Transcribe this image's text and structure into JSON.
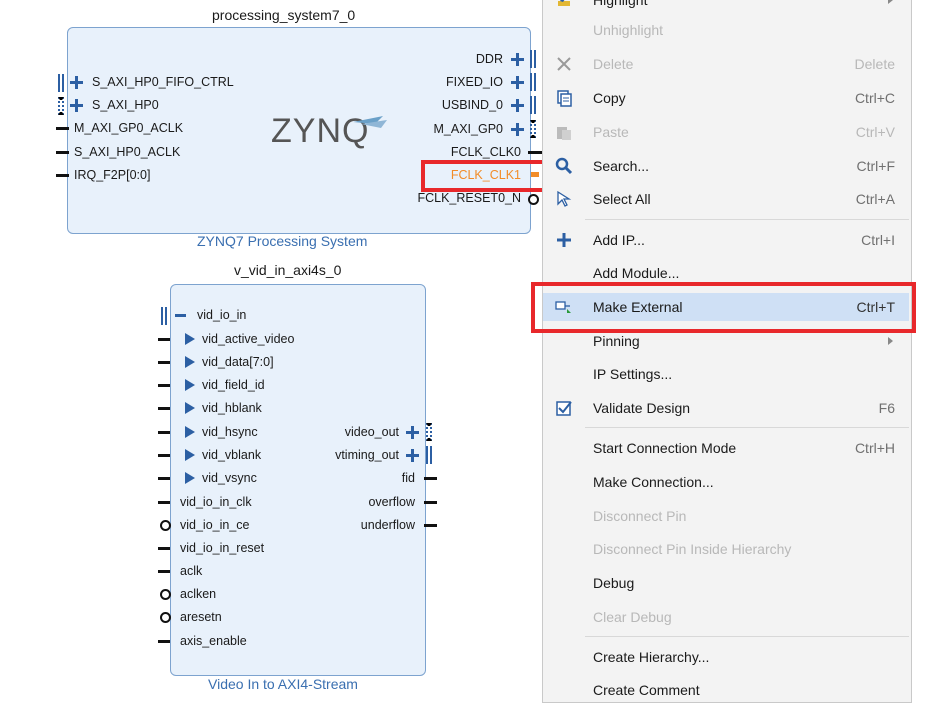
{
  "ps": {
    "title": "processing_system7_0",
    "subtitle": "ZYNQ7 Processing System",
    "logo": "ZYNQ",
    "left_pins": [
      "S_AXI_HP0_FIFO_CTRL",
      "S_AXI_HP0",
      "M_AXI_GP0_ACLK",
      "S_AXI_HP0_ACLK",
      "IRQ_F2P[0:0]"
    ],
    "right_pins": [
      "DDR",
      "FIXED_IO",
      "USBIND_0",
      "M_AXI_GP0",
      "FCLK_CLK0",
      "FCLK_CLK1",
      "FCLK_RESET0_N"
    ],
    "selected_pin": "FCLK_CLK1"
  },
  "vid": {
    "title": "v_vid_in_axi4s_0",
    "subtitle": "Video In to AXI4-Stream",
    "left_pins": [
      "vid_io_in",
      "vid_active_video",
      "vid_data[7:0]",
      "vid_field_id",
      "vid_hblank",
      "vid_hsync",
      "vid_vblank",
      "vid_vsync",
      "vid_io_in_clk",
      "vid_io_in_ce",
      "vid_io_in_reset",
      "aclk",
      "aclken",
      "aresetn",
      "axis_enable"
    ],
    "right_pins": [
      "video_out",
      "vtiming_out",
      "fid",
      "overflow",
      "underflow"
    ]
  },
  "menu": {
    "items": [
      {
        "label": "Highlight",
        "shortcut": "",
        "disabled": false,
        "submenu": true,
        "icon": "highlight-icon"
      },
      {
        "label": "Unhighlight",
        "shortcut": "",
        "disabled": true,
        "icon": ""
      },
      {
        "label": "Delete",
        "shortcut": "Delete",
        "disabled": true,
        "icon": "delete-x-icon"
      },
      {
        "label": "Copy",
        "shortcut": "Ctrl+C",
        "disabled": false,
        "icon": "copy-icon"
      },
      {
        "label": "Paste",
        "shortcut": "Ctrl+V",
        "disabled": true,
        "icon": "paste-icon"
      },
      {
        "label": "Search...",
        "shortcut": "Ctrl+F",
        "disabled": false,
        "icon": "search-icon"
      },
      {
        "label": "Select All",
        "shortcut": "Ctrl+A",
        "disabled": false,
        "icon": "select-all-icon"
      },
      {
        "label": "Add IP...",
        "shortcut": "Ctrl+I",
        "disabled": false,
        "icon": "add-icon"
      },
      {
        "label": "Add Module...",
        "shortcut": "",
        "disabled": false,
        "icon": ""
      },
      {
        "label": "Make External",
        "shortcut": "Ctrl+T",
        "disabled": false,
        "icon": "make-external-icon",
        "highlighted": true
      },
      {
        "label": "Pinning",
        "shortcut": "",
        "disabled": false,
        "submenu": true,
        "icon": ""
      },
      {
        "label": "IP Settings...",
        "shortcut": "",
        "disabled": false,
        "icon": ""
      },
      {
        "label": "Validate Design",
        "shortcut": "F6",
        "disabled": false,
        "icon": "validate-icon"
      },
      {
        "label": "Start Connection Mode",
        "shortcut": "Ctrl+H",
        "disabled": false,
        "icon": ""
      },
      {
        "label": "Make Connection...",
        "shortcut": "",
        "disabled": false,
        "icon": ""
      },
      {
        "label": "Disconnect Pin",
        "shortcut": "",
        "disabled": true,
        "icon": ""
      },
      {
        "label": "Disconnect Pin Inside Hierarchy",
        "shortcut": "",
        "disabled": true,
        "icon": ""
      },
      {
        "label": "Debug",
        "shortcut": "",
        "disabled": false,
        "icon": ""
      },
      {
        "label": "Clear Debug",
        "shortcut": "",
        "disabled": true,
        "icon": ""
      },
      {
        "label": "Create Hierarchy...",
        "shortcut": "",
        "disabled": false,
        "icon": ""
      },
      {
        "label": "Create Comment",
        "shortcut": "",
        "disabled": false,
        "icon": ""
      }
    ]
  },
  "colors": {
    "accent": "#2c5fa3",
    "highlight_box": "#e8282b",
    "selected_pin": "#f28c28",
    "menu_hover": "#cfe0f5"
  }
}
